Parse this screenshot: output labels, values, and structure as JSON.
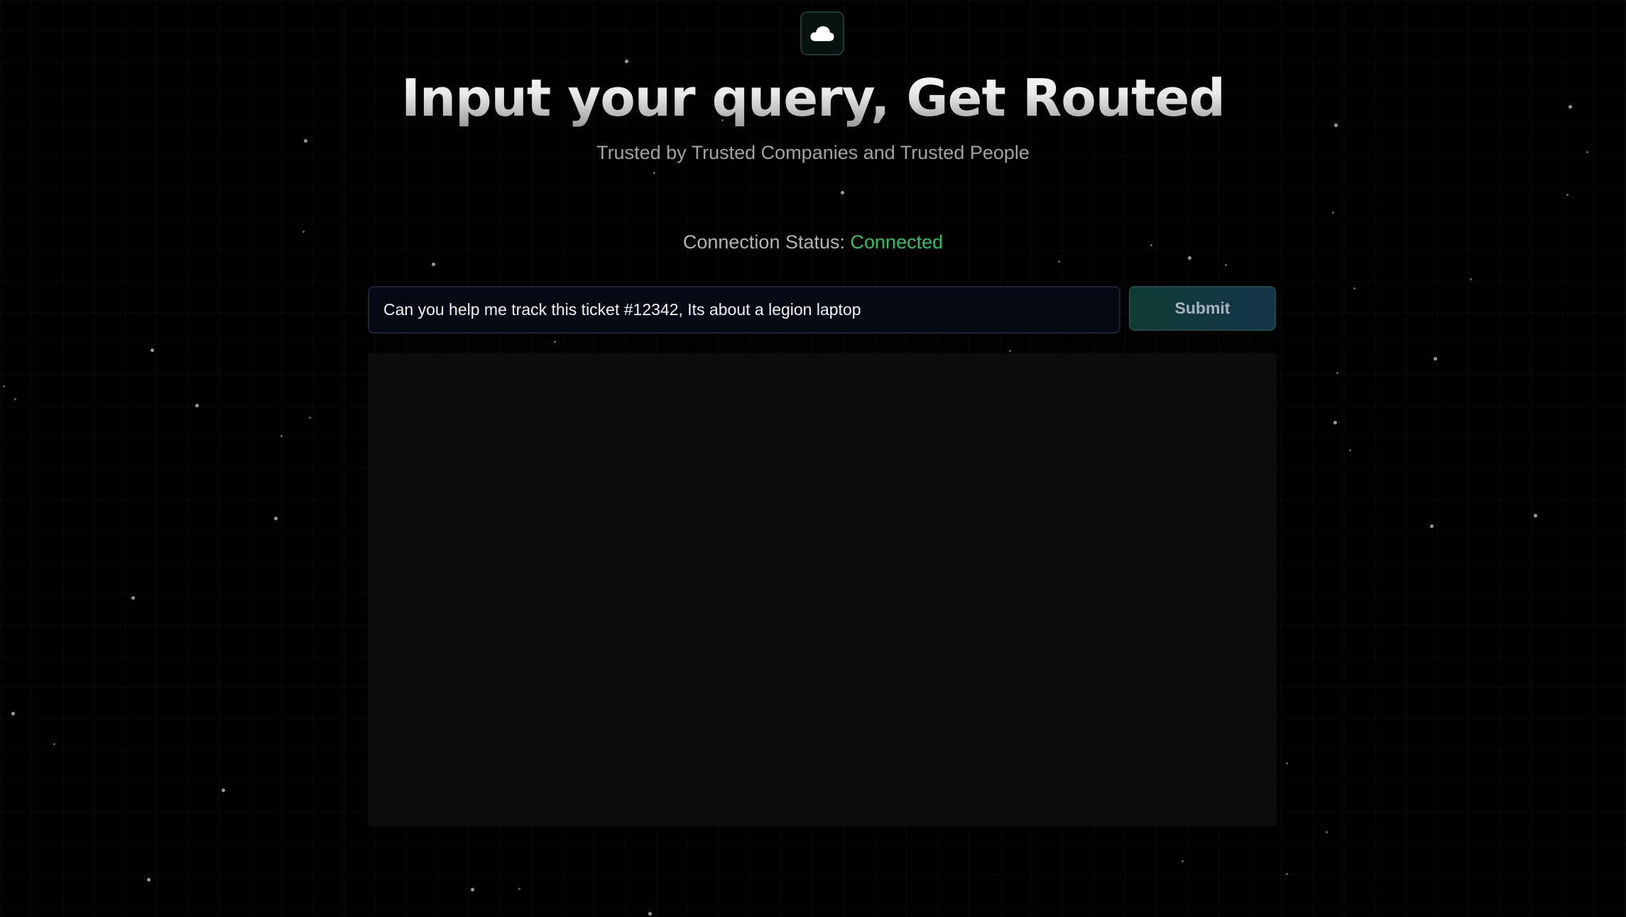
{
  "logo": {
    "icon": "cloud-icon"
  },
  "hero": {
    "title": "Input your query, Get Routed",
    "subtitle": "Trusted by Trusted Companies and Trusted People"
  },
  "connection": {
    "label": "Connection Status:",
    "value": "Connected",
    "value_color": "#22c55e"
  },
  "query": {
    "value": "Can you help me track this ticket #12342, Its about a legion laptop"
  },
  "submit": {
    "label": "Submit"
  },
  "output": {
    "text": ""
  }
}
